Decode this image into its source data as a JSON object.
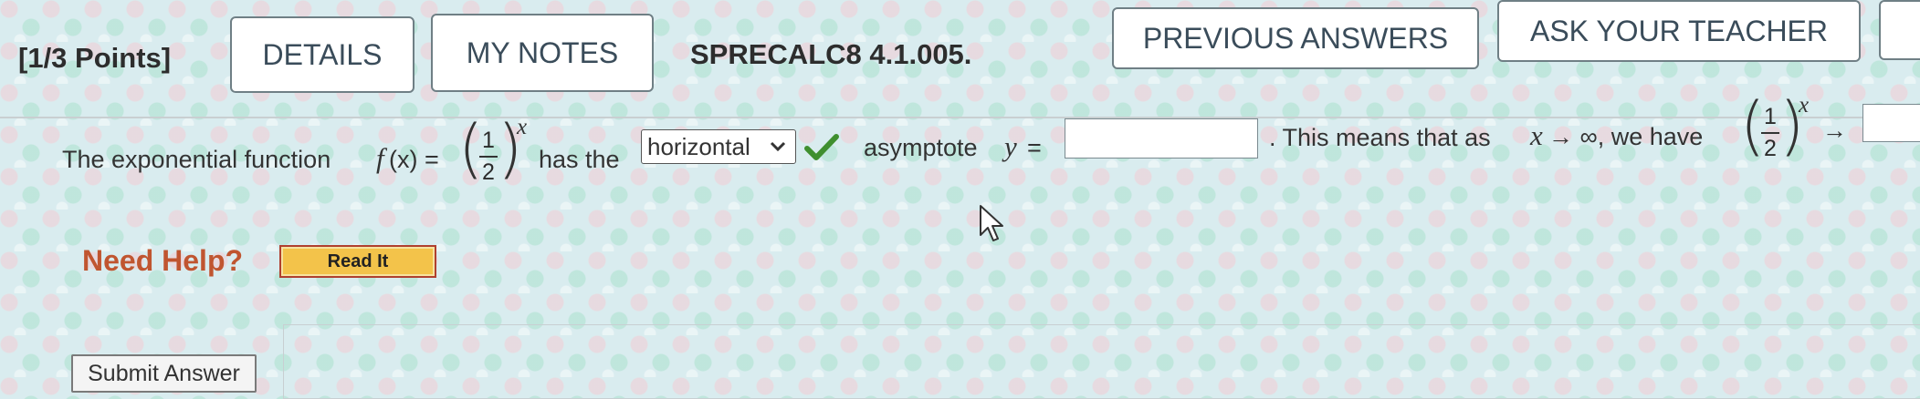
{
  "header": {
    "points": "[1/3 Points]",
    "details_label": "DETAILS",
    "my_notes_label": "MY NOTES",
    "problem_id": "SPRECALC8 4.1.005.",
    "previous_answers_label": "PREVIOUS ANSWERS",
    "ask_teacher_label": "ASK YOUR TEACHER"
  },
  "question": {
    "text_1": "The exponential function",
    "func_name": "f",
    "func_arg": "(x) =",
    "frac_num": "1",
    "frac_den": "2",
    "exponent": "x",
    "text_2": "has the",
    "select_value": "horizontal",
    "text_3": "asymptote",
    "var_y": "y",
    "equals": "=",
    "answer_1_value": "",
    "text_4": ". This means that as",
    "var_x": "x",
    "arrow_inf": "→ ∞, we have",
    "arrow": "→",
    "answer_2_value": ""
  },
  "help": {
    "need_help": "Need Help?",
    "read_it": "Read It"
  },
  "submit_label": "Submit Answer",
  "colors": {
    "need_help": "#c05530",
    "check": "#3f8f2f",
    "read_it_bg": "#f3c34a",
    "read_it_border": "#b0402f"
  },
  "icons": {
    "select_chevron": "chevron-down-icon",
    "correct_check": "checkmark-icon",
    "cursor": "mouse-pointer-icon"
  }
}
